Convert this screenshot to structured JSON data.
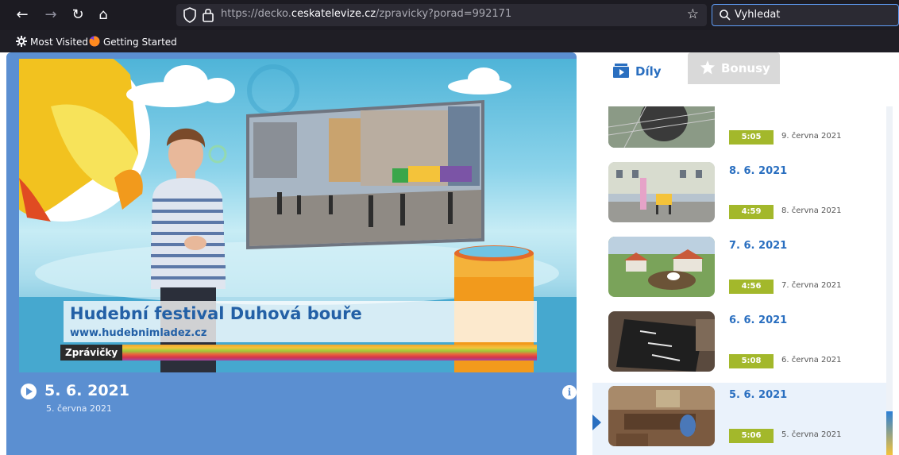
{
  "browser": {
    "url_prefix": "https://decko.",
    "url_domain": "ceskatelevize.cz",
    "url_path": "/zpravicky?porad=992171",
    "search_placeholder": "Vyhledat",
    "bookmarks": [
      "Most Visited",
      "Getting Started"
    ]
  },
  "player": {
    "lower_third_title": "Hudební festival Duhová bouře",
    "lower_third_url": "www.hudebnimladez.cz",
    "lower_third_tag": "Zprávičky",
    "episode_title": "5. 6. 2021",
    "episode_date": "5. června 2021",
    "info_label": "i"
  },
  "tabs": {
    "dily": "Díly",
    "bonusy": "Bonusy"
  },
  "episodes": [
    {
      "title": "",
      "duration": "5:05",
      "date": "9. června 2021"
    },
    {
      "title": "8. 6. 2021",
      "duration": "4:59",
      "date": "8. června 2021"
    },
    {
      "title": "7. 6. 2021",
      "duration": "4:56",
      "date": "7. června 2021"
    },
    {
      "title": "6. 6. 2021",
      "duration": "5:08",
      "date": "6. června 2021"
    },
    {
      "title": "5. 6. 2021",
      "duration": "5:06",
      "date": "5. června 2021"
    }
  ],
  "colors": {
    "accent_blue": "#2a6fc0",
    "player_blue": "#5b8fd1",
    "duration_green": "#a3b82b",
    "browser_dark": "#1c1b22"
  }
}
